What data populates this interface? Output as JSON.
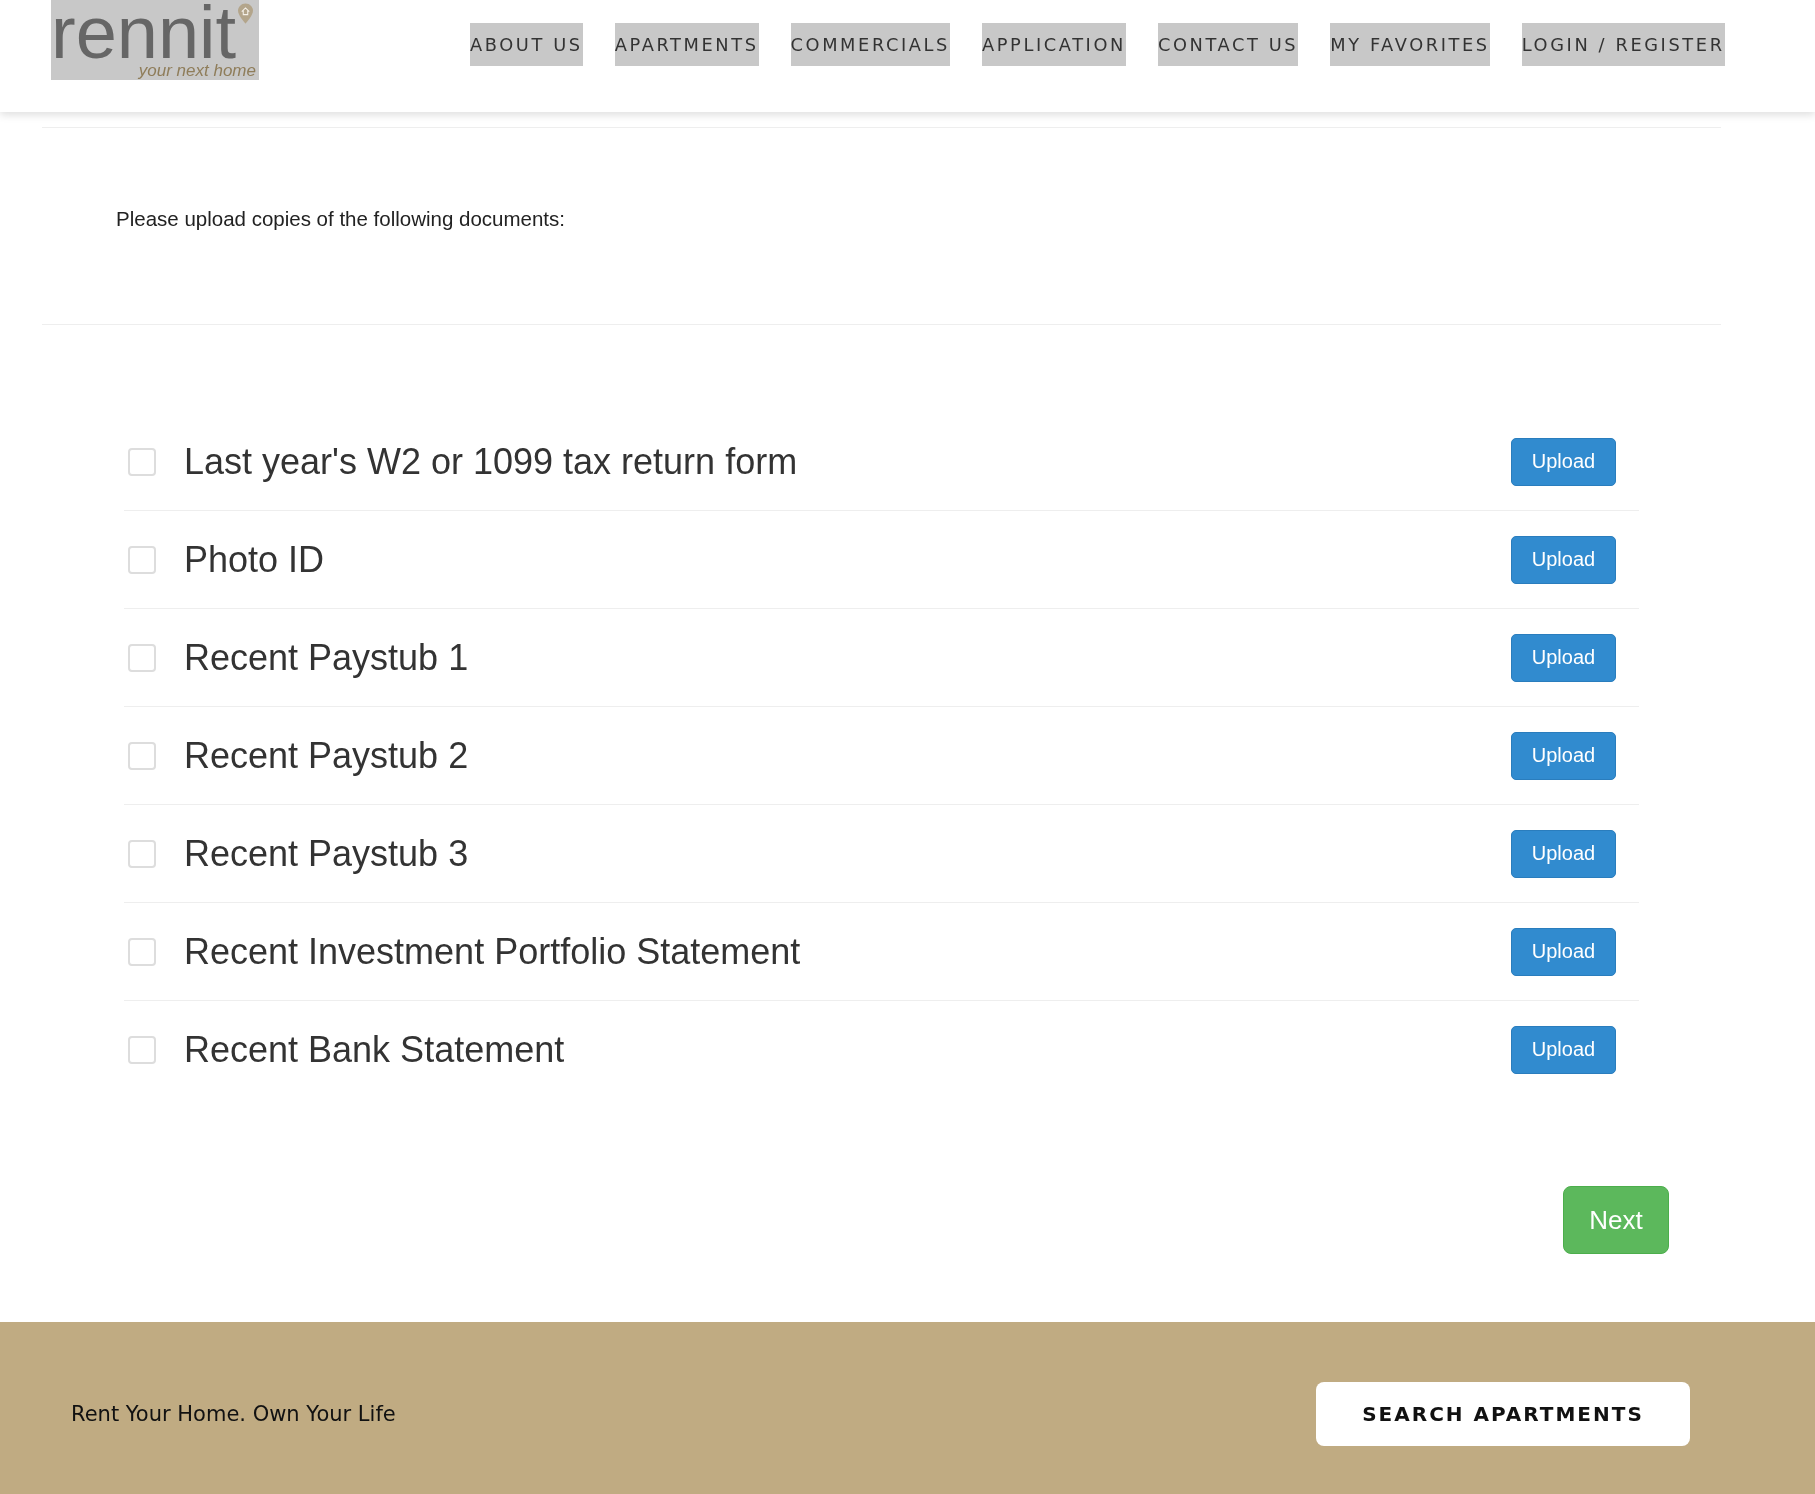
{
  "logo": {
    "name": "rennit",
    "tagline": "your next home"
  },
  "nav": [
    {
      "label": "ABOUT US"
    },
    {
      "label": "APARTMENTS"
    },
    {
      "label": "COMMERCIALS"
    },
    {
      "label": "APPLICATION"
    },
    {
      "label": "CONTACT US"
    },
    {
      "label": "MY FAVORITES"
    },
    {
      "label": "LOGIN / REGISTER"
    }
  ],
  "intro": "Please upload copies of the following documents:",
  "documents": [
    {
      "label": "Last year's W2 or 1099 tax return form",
      "checked": false,
      "button": "Upload"
    },
    {
      "label": "Photo ID",
      "checked": false,
      "button": "Upload"
    },
    {
      "label": "Recent Paystub 1",
      "checked": false,
      "button": "Upload"
    },
    {
      "label": "Recent Paystub 2",
      "checked": false,
      "button": "Upload"
    },
    {
      "label": "Recent Paystub 3",
      "checked": false,
      "button": "Upload"
    },
    {
      "label": "Recent Investment Portfolio Statement",
      "checked": false,
      "button": "Upload"
    },
    {
      "label": "Recent Bank Statement",
      "checked": false,
      "button": "Upload"
    }
  ],
  "next_button": "Next",
  "footer": {
    "tagline": "Rent Your Home. Own Your Life",
    "button": "SEARCH APARTMENTS"
  }
}
